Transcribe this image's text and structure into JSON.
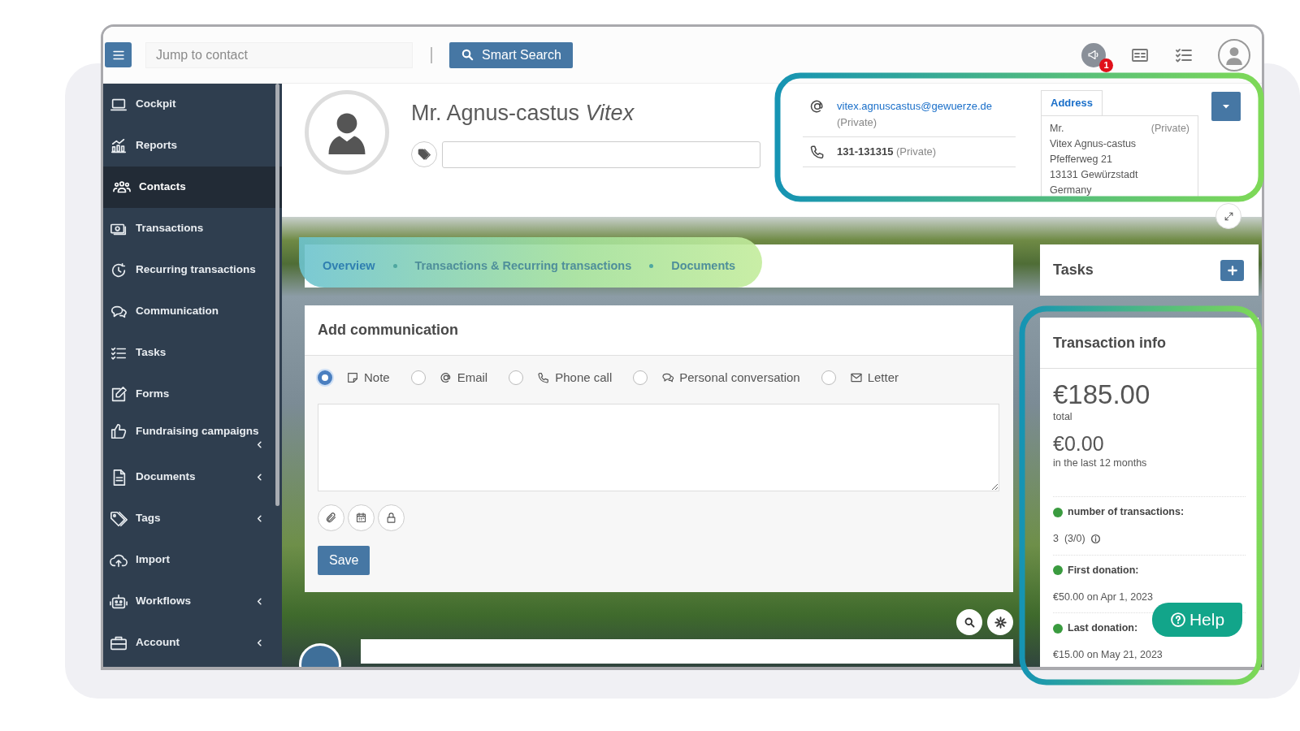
{
  "topbar": {
    "search_placeholder": "Jump to contact",
    "smart_search": "Smart Search",
    "notification_count": "1"
  },
  "sidebar": {
    "items": [
      {
        "label": "Cockpit",
        "selected": false,
        "submenu": false
      },
      {
        "label": "Reports",
        "selected": false,
        "submenu": false
      },
      {
        "label": "Contacts",
        "selected": true,
        "submenu": false
      },
      {
        "label": "Transactions",
        "selected": false,
        "submenu": false
      },
      {
        "label": "Recurring transactions",
        "selected": false,
        "submenu": false
      },
      {
        "label": "Communication",
        "selected": false,
        "submenu": false
      },
      {
        "label": "Tasks",
        "selected": false,
        "submenu": false
      },
      {
        "label": "Forms",
        "selected": false,
        "submenu": false
      },
      {
        "label": "Fundraising campaigns",
        "selected": false,
        "submenu": true
      },
      {
        "label": "Documents",
        "selected": false,
        "submenu": true
      },
      {
        "label": "Tags",
        "selected": false,
        "submenu": true
      },
      {
        "label": "Import",
        "selected": false,
        "submenu": false
      },
      {
        "label": "Workflows",
        "selected": false,
        "submenu": true
      },
      {
        "label": "Account",
        "selected": false,
        "submenu": true
      }
    ]
  },
  "contact": {
    "name": "Mr. Agnus-castus",
    "first_name": "Vitex"
  },
  "contact_details": [
    {
      "kind": "email",
      "value": "vitex.agnuscastus@gewuerze.de",
      "type": "(Private)"
    },
    {
      "kind": "phone",
      "value": "131-131315",
      "type": "(Private)"
    }
  ],
  "address": {
    "tab": "Address",
    "salutation": "Mr.",
    "type": "(Private)",
    "lines": [
      "Vitex Agnus-castus",
      "Pfefferweg 21",
      "13131 Gewürzstadt",
      "Germany"
    ]
  },
  "tabs": [
    {
      "label": "Overview",
      "selected": true
    },
    {
      "label": "Transactions & Recurring transactions",
      "selected": false
    },
    {
      "label": "Documents",
      "selected": false
    }
  ],
  "add_communication": {
    "title": "Add communication",
    "save": "Save",
    "types": [
      {
        "kind": "note",
        "label": "Note",
        "selected": true
      },
      {
        "kind": "email",
        "label": "Email",
        "selected": false
      },
      {
        "kind": "phone",
        "label": "Phone call",
        "selected": false
      },
      {
        "kind": "conversation",
        "label": "Personal conversation",
        "selected": false
      },
      {
        "kind": "letter",
        "label": "Letter",
        "selected": false
      }
    ]
  },
  "tasks": {
    "title": "Tasks"
  },
  "transaction_info": {
    "title": "Transaction info",
    "total": "€185.00",
    "total_label": "total",
    "recent": "€0.00",
    "recent_label": "in the last 12 months",
    "stats": [
      {
        "label": "number of transactions:",
        "value": "3  (3/0)",
        "info": true
      },
      {
        "label": "First donation:",
        "value": "€50.00 on Apr 1, 2023",
        "info": false
      },
      {
        "label": "Last donation:",
        "value": "€15.00 on May 21, 2023",
        "info": false
      }
    ]
  },
  "help": "Help"
}
